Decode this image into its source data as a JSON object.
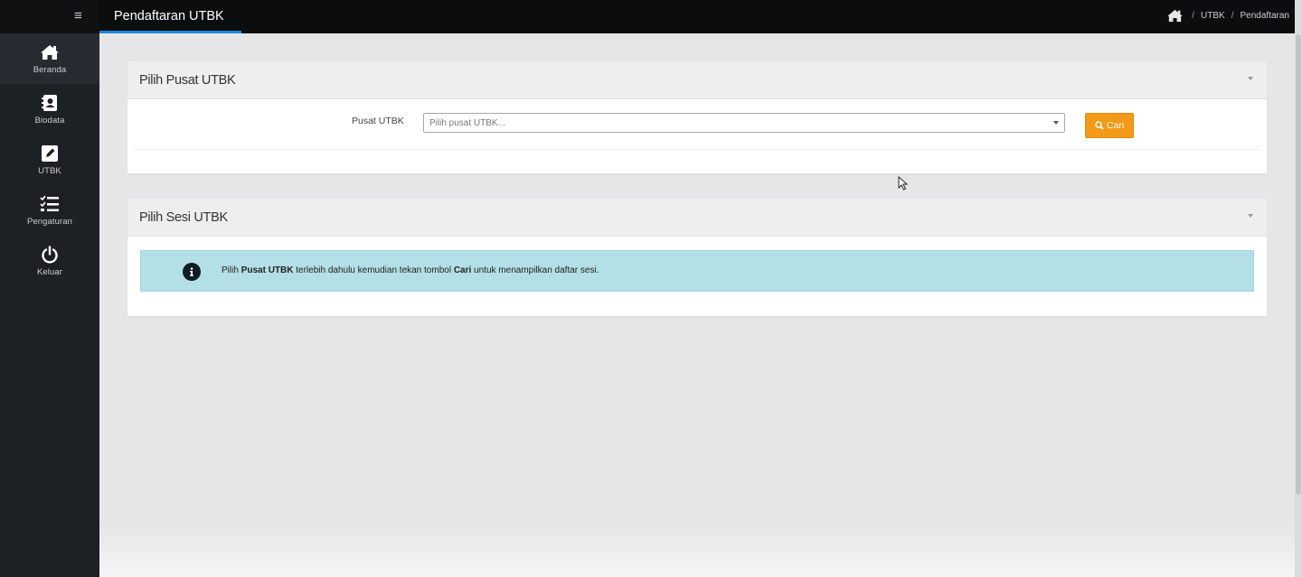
{
  "sidebar": {
    "menu_icon": "hamburger-icon",
    "items": [
      {
        "label": "Beranda",
        "icon": "home-icon"
      },
      {
        "label": "Biodata",
        "icon": "address-book-icon"
      },
      {
        "label": "UTBK",
        "icon": "edit-icon"
      },
      {
        "label": "Pengaturan",
        "icon": "checklist-icon"
      },
      {
        "label": "Keluar",
        "icon": "power-icon"
      }
    ]
  },
  "header": {
    "title": "Pendaftaran UTBK",
    "breadcrumb": {
      "home_icon": "home-icon",
      "separator": "/",
      "items": [
        "UTBK",
        "Pendaftaran"
      ]
    }
  },
  "panel_pusat": {
    "title": "Pilih Pusat UTBK",
    "label": "Pusat UTBK",
    "select_placeholder": "Pilih pusat UTBK...",
    "button_label": "Cari",
    "button_icon": "search-icon"
  },
  "panel_sesi": {
    "title": "Pilih Sesi UTBK",
    "info_icon": "info-icon",
    "info_parts": {
      "p1": "Pilih ",
      "b1": "Pusat UTBK",
      "p2": " terlebih dahulu kemudian tekan tombol ",
      "b2": "Cari",
      "p3": " untuk menampilkan daftar sesi."
    }
  },
  "colors": {
    "sidebar": "#1d2126",
    "header": "#0c0d0f",
    "accent_underline": "#1f87d6",
    "button": "#f39a18",
    "info_alert": "#b3dfe6"
  }
}
